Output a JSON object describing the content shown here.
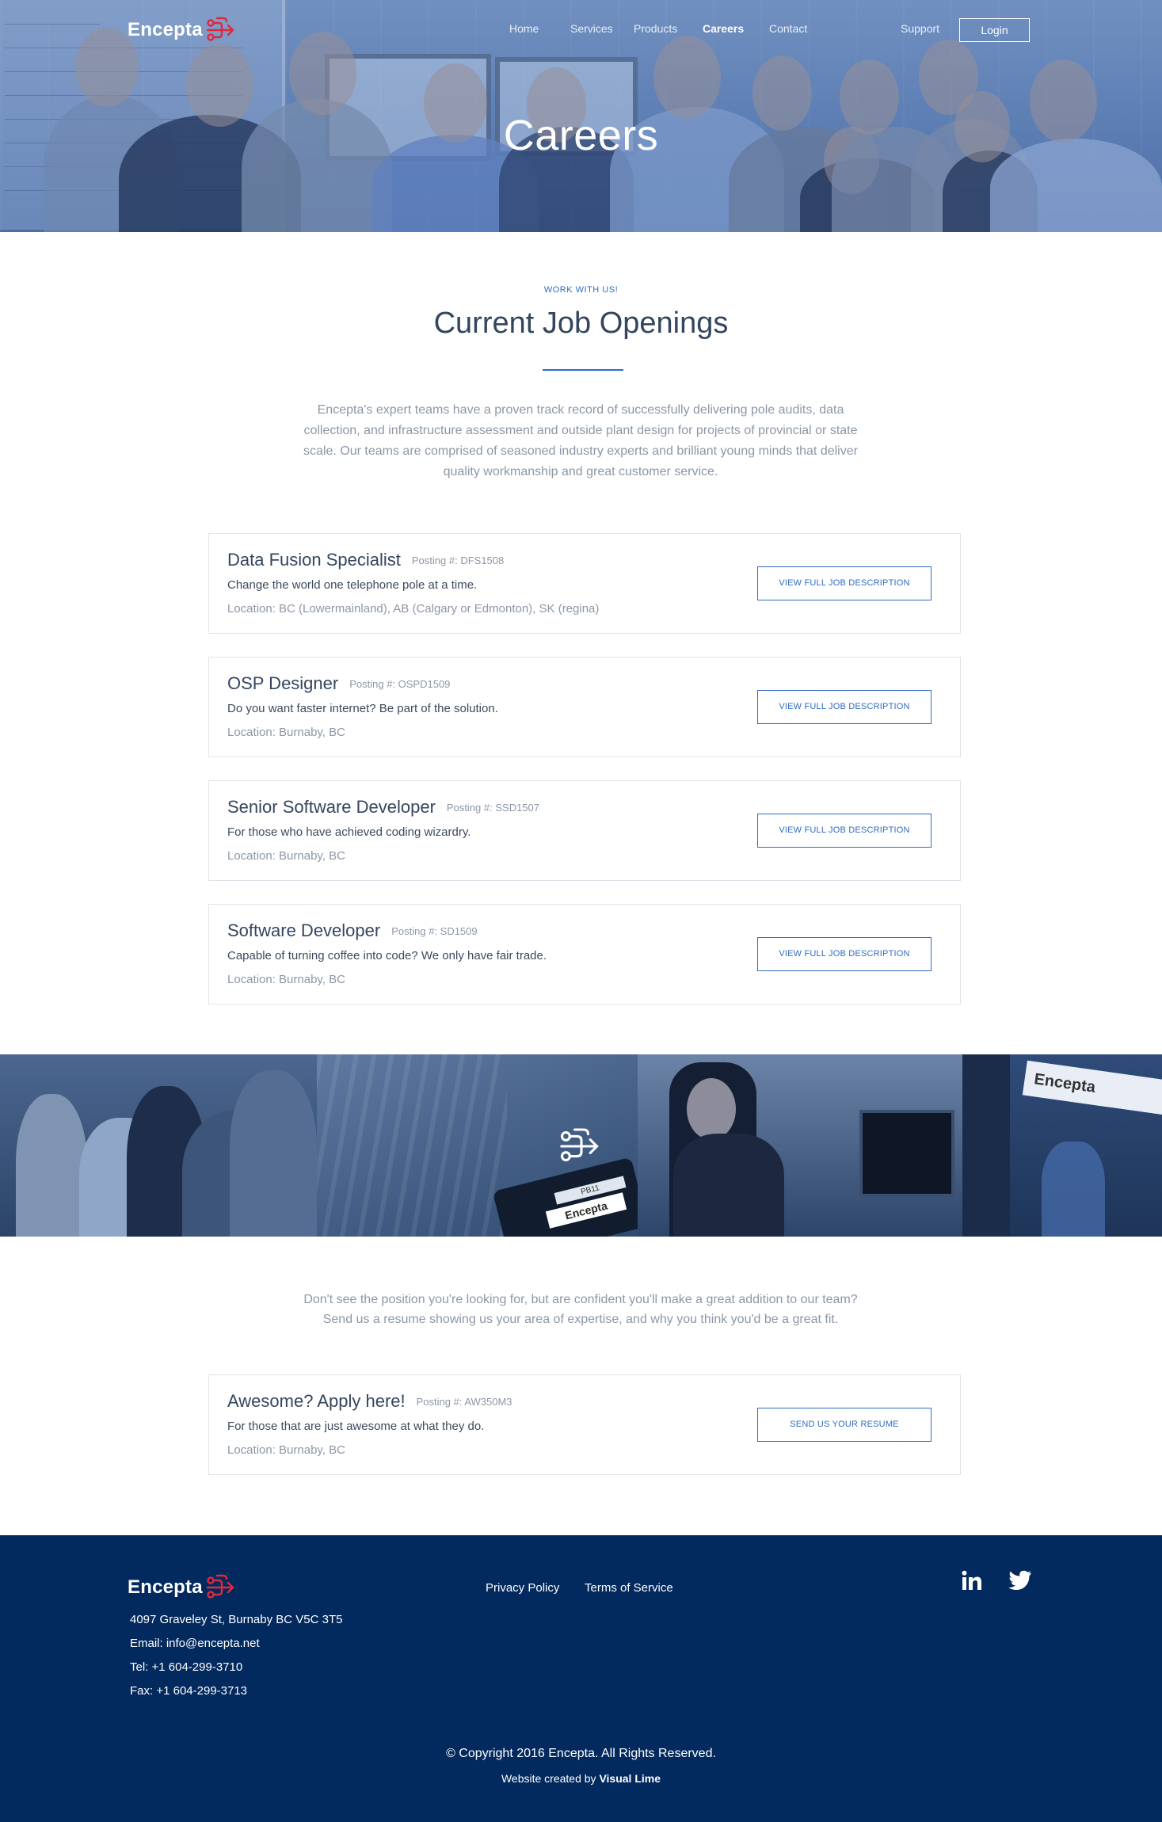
{
  "brand": {
    "name": "Encepta",
    "accent": "#e0283c",
    "primary": "#2f6cc4",
    "footer_bg": "#032a5e"
  },
  "nav": {
    "items": [
      {
        "label": "Home"
      },
      {
        "label": "Services"
      },
      {
        "label": "Products"
      },
      {
        "label": "Careers",
        "active": true
      },
      {
        "label": "Contact"
      }
    ],
    "support": "Support",
    "login": "Login"
  },
  "hero": {
    "title": "Careers"
  },
  "openings": {
    "eyebrow": "WORK WITH US!",
    "title": "Current Job Openings",
    "intro": "Encepta's expert teams have a proven track record of successfully delivering pole audits, data collection, and infrastructure assessment and outside plant design for projects of provincial or state scale. Our teams are comprised of seasoned industry experts and brilliant young minds that deliver quality workmanship and great customer service.",
    "jobs": [
      {
        "title": "Data Fusion Specialist",
        "posting": "Posting #: DFS1508",
        "tagline": "Change the world one telephone pole at a time.",
        "location": "Location: BC (Lowermainland), AB (Calgary or Edmonton), SK (regina)",
        "button": "VIEW FULL JOB DESCRIPTION"
      },
      {
        "title": "OSP Designer",
        "posting": "Posting #: OSPD1509",
        "tagline": "Do you want faster internet? Be part of the solution.",
        "location": "Location: Burnaby, BC",
        "button": "VIEW FULL JOB DESCRIPTION"
      },
      {
        "title": "Senior Software Developer",
        "posting": "Posting #: SSD1507",
        "tagline": "For those who have achieved coding wizardry.",
        "location": "Location: Burnaby, BC",
        "button": "VIEW FULL JOB DESCRIPTION"
      },
      {
        "title": "Software Developer",
        "posting": "Posting #: SD1509",
        "tagline": "Capable of turning coffee into code? We only have fair trade.",
        "location": "Location: Burnaby, BC",
        "button": "VIEW FULL JOB DESCRIPTION"
      }
    ]
  },
  "strip": {
    "sign_text": "Encepta",
    "device_label": "PB11"
  },
  "apply": {
    "text_line1": "Don't see the position you're looking for, but are confident you'll make a great addition to our team?",
    "text_line2": "Send us a resume showing us your area of expertise, and why you think you'd be a great fit.",
    "card": {
      "title": "Awesome? Apply here!",
      "posting": "Posting #: AW350M3",
      "tagline": "For those that are just awesome at what they do.",
      "location": "Location: Burnaby, BC",
      "button": "SEND US YOUR RESUME"
    }
  },
  "footer": {
    "address": "4097 Graveley St, Burnaby BC V5C 3T5",
    "email": "Email: info@encepta.net",
    "tel": "Tel: +1 604-299-3710",
    "fax": "Fax: +1 604-299-3713",
    "links": [
      "Privacy Policy",
      "Terms of Service"
    ],
    "social": [
      "linkedin-icon",
      "twitter-icon"
    ],
    "copyright": "© Copyright 2016 Encepta. All Rights Reserved.",
    "credit_prefix": "Website created by",
    "credit_name": "Visual Lime"
  }
}
